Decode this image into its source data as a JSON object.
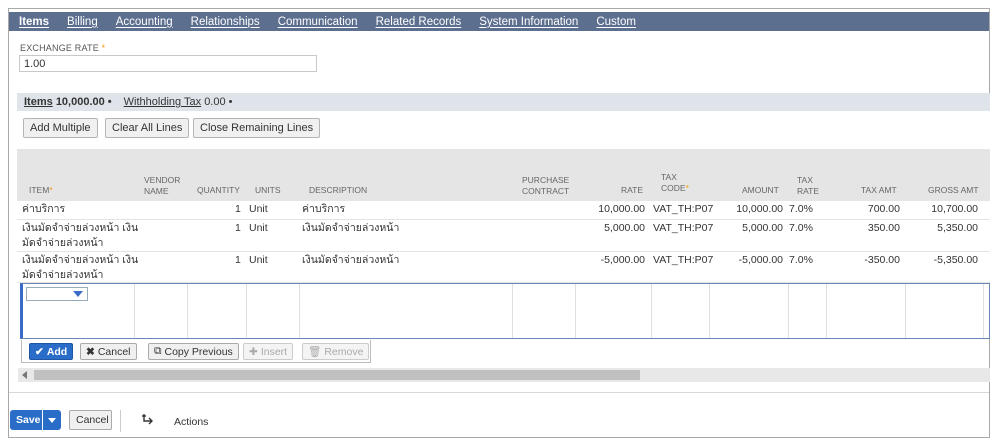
{
  "tabs": [
    "Items",
    "Billing",
    "Accounting",
    "Relationships",
    "Communication",
    "Related Records",
    "System Information",
    "Custom"
  ],
  "exchange_rate": {
    "label": "EXCHANGE RATE",
    "required": "*",
    "value": "1.00"
  },
  "subtabs": {
    "items": {
      "label": "Items",
      "amount": "10,000.00"
    },
    "withholding": {
      "label": "Withholding Tax",
      "amount": "0.00"
    }
  },
  "grid_buttons": {
    "add_multiple": "Add Multiple",
    "clear_all": "Clear All Lines",
    "close_remaining": "Close Remaining Lines"
  },
  "columns": {
    "item": "ITEM",
    "vendor1": "VENDOR",
    "vendor2": "NAME",
    "quantity": "QUANTITY",
    "units": "UNITS",
    "description": "DESCRIPTION",
    "purchase1": "PURCHASE",
    "purchase2": "CONTRACT",
    "rate": "RATE",
    "taxcode1": "TAX",
    "taxcode2": "CODE",
    "amount": "AMOUNT",
    "taxrate1": "TAX",
    "taxrate2": "RATE",
    "taxamt": "TAX AMT",
    "grossamt": "GROSS AMT"
  },
  "rows": [
    {
      "item1": "ค่าบริการ",
      "item2": "",
      "quantity": "1",
      "units": "Unit",
      "description": "ค่าบริการ",
      "rate": "10,000.00",
      "tax_code": "VAT_TH:P07",
      "amount": "10,000.00",
      "tax_rate": "7.0%",
      "tax_amt": "700.00",
      "gross_amt": "10,700.00"
    },
    {
      "item1": "เงินมัดจำจ่ายล่วงหน้า เงิน",
      "item2": "มัดจำจ่ายล่วงหน้า",
      "quantity": "1",
      "units": "Unit",
      "description": "เงินมัดจำจ่ายล่วงหน้า",
      "rate": "5,000.00",
      "tax_code": "VAT_TH:P07",
      "amount": "5,000.00",
      "tax_rate": "7.0%",
      "tax_amt": "350.00",
      "gross_amt": "5,350.00"
    },
    {
      "item1": "เงินมัดจำจ่ายล่วงหน้า เงิน",
      "item2": "มัดจำจ่ายล่วงหน้า",
      "quantity": "1",
      "units": "Unit",
      "description": "เงินมัดจำจ่ายล่วงหน้า",
      "rate": "-5,000.00",
      "tax_code": "VAT_TH:P07",
      "amount": "-5,000.00",
      "tax_rate": "7.0%",
      "tax_amt": "-350.00",
      "gross_amt": "-5,350.00"
    }
  ],
  "line_toolbar": {
    "add": "Add",
    "cancel": "Cancel",
    "copy_previous": "Copy Previous",
    "insert": "Insert",
    "remove": "Remove"
  },
  "footer": {
    "save": "Save",
    "cancel": "Cancel",
    "actions": "Actions"
  },
  "colors": {
    "tab_bar": "#5c6f8f",
    "primary": "#2a6dc9",
    "required": "#f49b0b",
    "subtab_bar": "#dfe4eb"
  }
}
